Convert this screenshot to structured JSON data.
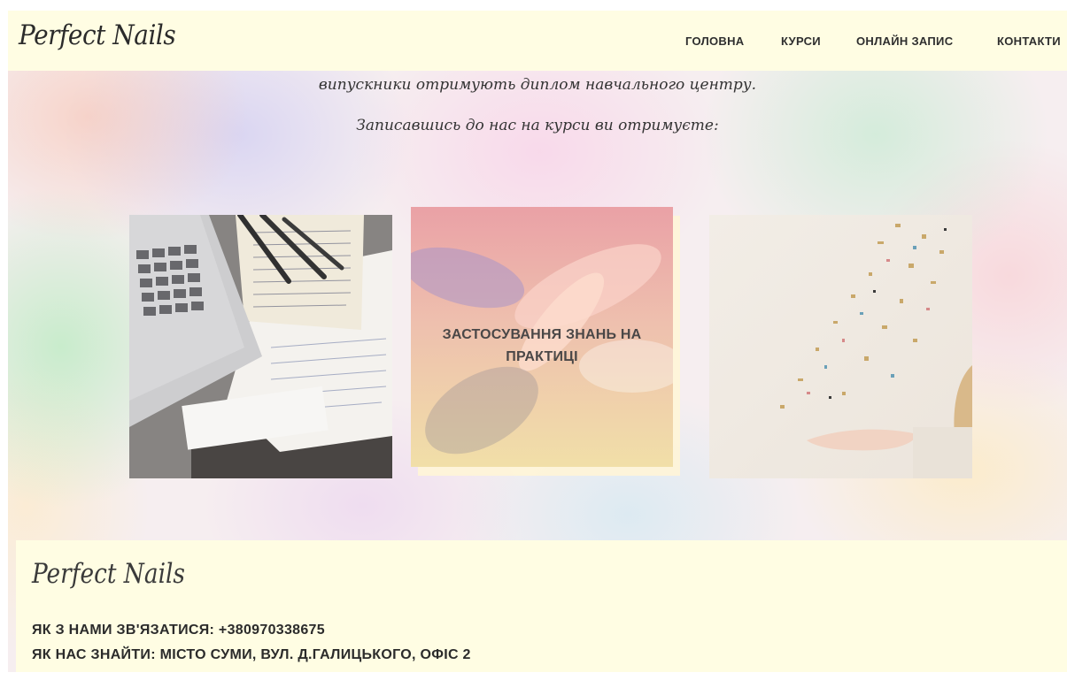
{
  "header": {
    "logo": "Perfect Nails",
    "nav": [
      {
        "label": "ГОЛОВНА"
      },
      {
        "label": "КУРСИ"
      },
      {
        "label": "ОНЛАЙН ЗАПИС"
      },
      {
        "label": "КОНТАКТИ"
      }
    ]
  },
  "intro": {
    "line1": "випускники отримують диплом навчального центру.",
    "line2": "Записавшись до нас на курси ви отримуєте:"
  },
  "cards": [
    {
      "image": "laptop-notes-photo",
      "caption": ""
    },
    {
      "image": "manicure-hands-photo",
      "caption": "ЗАСТОСУВАННЯ ЗНАНЬ НА ПРАКТИЦІ"
    },
    {
      "image": "confetti-hand-photo",
      "caption": ""
    }
  ],
  "footer": {
    "logo": "Perfect Nails",
    "contact": "ЯК З НАМИ ЗВ'ЯЗАТИСЯ: +380970338675",
    "address": "ЯК НАС ЗНАЙТИ: МІСТО СУМИ, ВУЛ. Д.ГАЛИЦЬКОГО, ОФІС 2"
  },
  "colors": {
    "header_bg": "#fffde3",
    "footer_bg": "#fffde3",
    "text": "#2b2b2b"
  }
}
